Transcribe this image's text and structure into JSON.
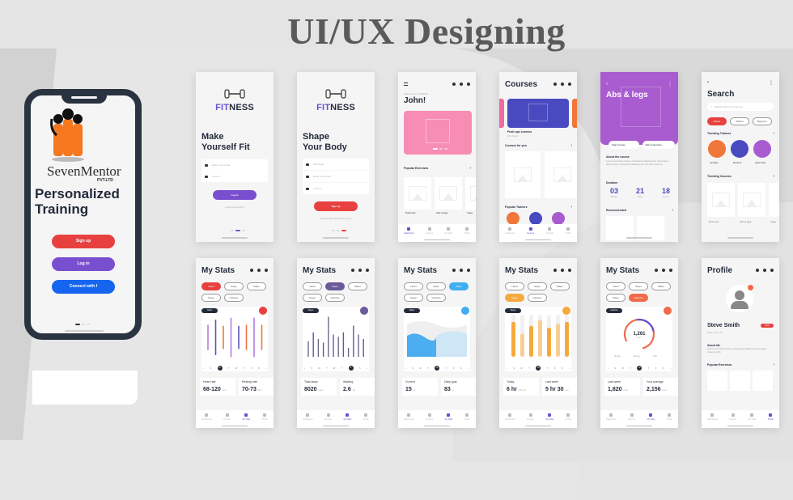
{
  "page_title": "UI/UX Designing",
  "promo_phone": {
    "brand": "SevenMentor",
    "brand_suffix": "PVT.LTD",
    "headline_line1": "Personalized",
    "headline_line2": "Training",
    "buttons": [
      {
        "label": "Sign up",
        "color": "#e8403f"
      },
      {
        "label": "Log in",
        "color": "#7a4fcf"
      },
      {
        "label": "Connect with  f",
        "color": "#1565f0"
      }
    ]
  },
  "login_screen": {
    "logo_a": "FIT",
    "logo_b": "NESS",
    "title_line1": "Make",
    "title_line2": "Yourself Fit",
    "email_placeholder": "Enter your email",
    "password_placeholder": "••••••••••",
    "button": "Log in",
    "forgot": "Forgot password?"
  },
  "signup_screen": {
    "logo_a": "FIT",
    "logo_b": "NESS",
    "title_line1": "Shape",
    "title_line2": "Your Body",
    "name_placeholder": "Full name",
    "email_placeholder": "Enter your email",
    "password_placeholder": "••••••••••",
    "button": "Sign up",
    "have_account": "Already have account? Log in"
  },
  "dashboard_screen": {
    "welcome": "Welcome to FITNESS",
    "name": "John!",
    "popular_label": "Popular Exercises",
    "exercises": [
      {
        "name": "Push ups",
        "sub": "30 min"
      },
      {
        "name": "Abs & legs",
        "sub": "15 min"
      },
      {
        "name": "Yoga",
        "sub": "20 min"
      }
    ]
  },
  "courses_screen": {
    "title": "Courses",
    "featured": "Push ups courses",
    "featured_sub": "130 hours",
    "courses_for_you": "Courses for you",
    "popular_trainers": "Popular Trainers"
  },
  "course_detail_screen": {
    "title": "Abs & legs",
    "start_btn": "Start Course",
    "fav_btn": "Add to favorites",
    "about_label": "About the course",
    "about_text": "Lorem ipsum dolor sit amet, consectetuer adipiscing elit. Lorem ipsum dolor sit amet, consectetuer adipiscing elit, sed diam nonummy.",
    "duration_label": "Duration",
    "duration": [
      {
        "value": "03",
        "unit": "Weeks"
      },
      {
        "value": "21",
        "unit": "Days"
      },
      {
        "value": "18",
        "unit": "Hours"
      }
    ],
    "recommended": "Recommended"
  },
  "search_screen": {
    "title": "Search",
    "placeholder": "Search trainers or courses",
    "filters": [
      "Starter",
      "Skilled",
      "Beginner"
    ],
    "trending_trainers": "Trending Trainers",
    "trainers": [
      {
        "name": "Jennifer",
        "role": "Yoga trainer",
        "color": "#f0763a"
      },
      {
        "name": "Doris G",
        "role": "Boxing trainer",
        "color": "#4a4ac0"
      },
      {
        "name": "Irene Doe",
        "role": "Yoga Trainer",
        "color": "#a85ccf"
      }
    ],
    "trending_courses": "Trending Courses",
    "courses": [
      "Push ups",
      "Abs & legs",
      "Yoga"
    ]
  },
  "nav": {
    "items": [
      "Dashboard",
      "Courses",
      "My Stats",
      "Profile"
    ]
  },
  "stats_common": {
    "title": "My Stats",
    "chips": [
      "Heart",
      "Steps",
      "Water",
      "Sleep",
      "Calories"
    ],
    "days": [
      "‹",
      "S",
      "M",
      "T",
      "W",
      "T",
      "F",
      "S",
      "›"
    ]
  },
  "stats_heart": {
    "active_chip": "Heart",
    "accent": "#e8403f",
    "badge": "Heart",
    "current_day_index": 2,
    "card1_label": "Heart rate",
    "card1_value": "68-120",
    "card1_unit": "bpm",
    "card2_label": "Resting rate",
    "card2_value": "70-73",
    "card2_unit": "bpm"
  },
  "stats_steps": {
    "active_chip": "Steps",
    "accent": "#6a5a9a",
    "badge": "Steps",
    "current_day_index": 6,
    "card1_label": "Total steps",
    "card1_value": "8020",
    "card1_unit": "steps",
    "card2_label": "Walking",
    "card2_value": "2.6",
    "card2_unit": "km"
  },
  "stats_water": {
    "active_chip": "Water",
    "accent": "#41aef0",
    "badge": "Water",
    "current_day_index": 4,
    "card1_label": "Current",
    "card1_value": "15",
    "card1_unit": "oz",
    "card2_label": "Daily goal",
    "card2_value": "83",
    "card2_unit": "oz"
  },
  "stats_sleep": {
    "active_chip": "Sleep",
    "accent": "#f5a93c",
    "badge": "Sleep",
    "current_day_index": 4,
    "card1_label": "Today",
    "card1_value": "6 hr",
    "card1_unit": "fell at 11",
    "card2_label": "Last week",
    "card2_value": "5 hr 30",
    "card2_unit": "min"
  },
  "stats_calories": {
    "active_chip": "Calories",
    "accent": "#f06a4a",
    "badge": "Calories",
    "current_day_index": 4,
    "ring_value": "1,261",
    "ring_unit": "Kcal",
    "legend": [
      "Protein",
      "Energy",
      "Fats"
    ],
    "card1_label": "Last week",
    "card1_value": "1,820",
    "card1_unit": "kCal",
    "card2_label": "Your average",
    "card2_value": "2,156",
    "card2_unit": "kCal"
  },
  "profile_screen": {
    "title": "Profile",
    "name": "Steve Smith",
    "badge": "PRO",
    "location": "New York, NY",
    "about_label": "About Me",
    "about_text": "Lorem ipsum dolor sit amet, consectetuer adipiscing elit, sed diam nonummy nibh.",
    "popular_label": "Popular Exercises"
  },
  "chart_data": [
    {
      "type": "bar",
      "title": "Heart",
      "series": [
        {
          "name": "a",
          "values": [
            0.6,
            0.85,
            0.55,
            0.95,
            0.55,
            0.6,
            0.95,
            0.6
          ]
        }
      ]
    },
    {
      "type": "bar",
      "title": "Steps",
      "values": [
        0.35,
        0.55,
        0.4,
        0.32,
        0.9,
        0.5,
        0.45,
        0.55,
        0.2,
        0.7,
        0.5,
        0.4
      ]
    },
    {
      "type": "area",
      "title": "Water",
      "values": [
        0.7,
        0.5
      ]
    },
    {
      "type": "bar",
      "title": "Sleep",
      "values": [
        0.9,
        0.6,
        0.8,
        0.95,
        0.75,
        0.85,
        0.9
      ]
    },
    {
      "type": "pie",
      "title": "Calories",
      "values": [
        1261
      ]
    }
  ]
}
